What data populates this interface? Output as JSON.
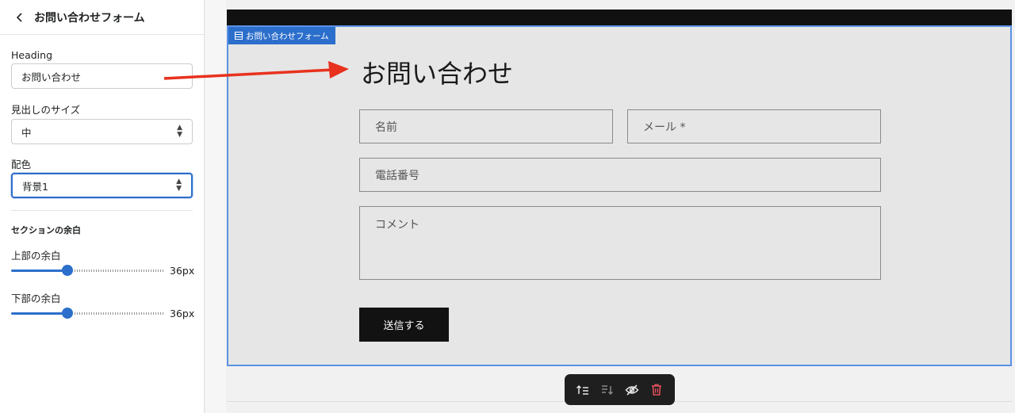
{
  "sidebar": {
    "title": "お問い合わせフォーム",
    "heading_label": "Heading",
    "heading_value": "お問い合わせ",
    "size_label": "見出しのサイズ",
    "size_value": "中",
    "color_label": "配色",
    "color_value": "背景1",
    "padding_section_title": "セクションの余白",
    "top_padding_label": "上部の余白",
    "top_padding_value": "36px",
    "top_padding_level": 0.37,
    "bottom_padding_label": "下部の余白",
    "bottom_padding_value": "36px",
    "bottom_padding_level": 0.37
  },
  "preview": {
    "section_tag": "お問い合わせフォーム",
    "heading": "お問い合わせ",
    "fields": {
      "name_placeholder": "名前",
      "email_placeholder": "メール *",
      "phone_placeholder": "電話番号",
      "comment_placeholder": "コメント"
    },
    "submit_label": "送信する"
  },
  "colors": {
    "accent": "#2c6ecb",
    "annotation_arrow": "#e8321e",
    "delete_icon": "#e0505a"
  },
  "icons": [
    "chevron-left-icon",
    "section-grid-icon",
    "move-up-icon",
    "move-down-icon",
    "hide-icon",
    "delete-icon"
  ]
}
